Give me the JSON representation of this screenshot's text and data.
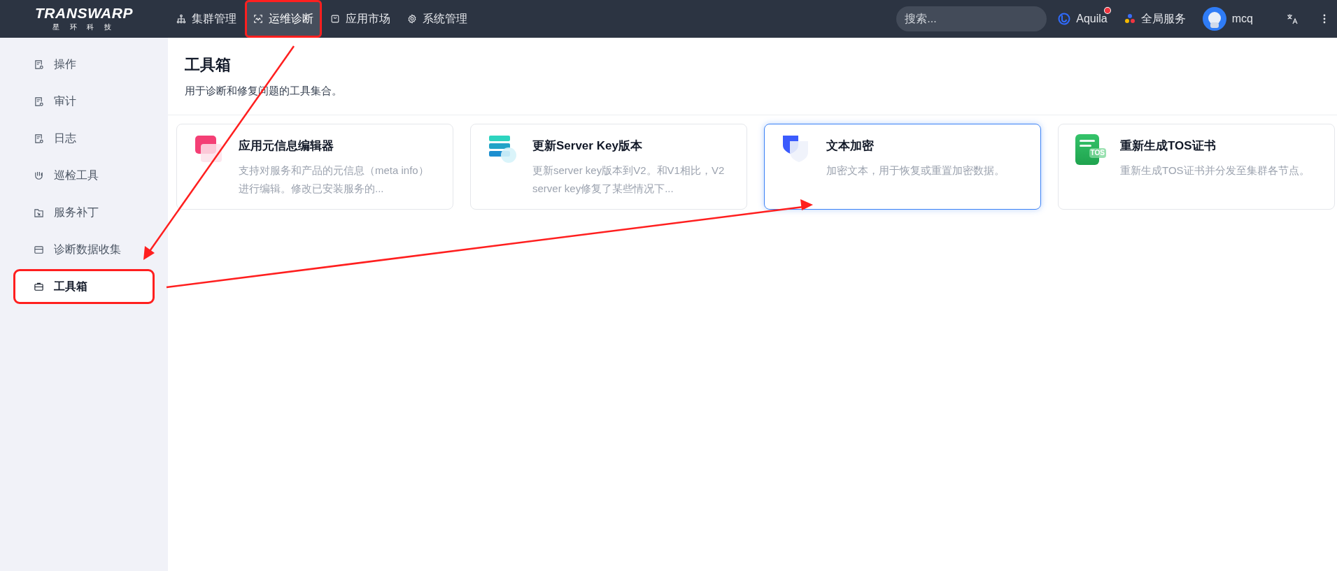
{
  "logo": {
    "name": "TRANSWARP",
    "subtitle": "星 环 科 技"
  },
  "nav": [
    {
      "label": "集群管理",
      "kind": "sitemap",
      "selected": false,
      "annotated": false
    },
    {
      "label": "运维诊断",
      "kind": "scan",
      "selected": true,
      "annotated": true
    },
    {
      "label": "应用市场",
      "kind": "bag",
      "selected": false,
      "annotated": false
    },
    {
      "label": "系统管理",
      "kind": "gear",
      "selected": false,
      "annotated": false
    }
  ],
  "search": {
    "placeholder": "搜索..."
  },
  "aquila": {
    "label": "Aquila",
    "notification": true
  },
  "global_services": {
    "label": "全局服务"
  },
  "user": {
    "name": "mcq"
  },
  "sidebar": {
    "items": [
      {
        "label": "操作",
        "kind": "doc",
        "selected": false,
        "annotated": false
      },
      {
        "label": "审计",
        "kind": "doc",
        "selected": false,
        "annotated": false
      },
      {
        "label": "日志",
        "kind": "doc",
        "selected": false,
        "annotated": false
      },
      {
        "label": "巡检工具",
        "kind": "hand",
        "selected": false,
        "annotated": false
      },
      {
        "label": "服务补丁",
        "kind": "folder",
        "selected": false,
        "annotated": false
      },
      {
        "label": "诊断数据收集",
        "kind": "box",
        "selected": false,
        "annotated": false
      },
      {
        "label": "工具箱",
        "kind": "toolbox",
        "selected": true,
        "annotated": true
      }
    ]
  },
  "page": {
    "title": "工具箱",
    "subtitle": "用于诊断和修复问题的工具集合。"
  },
  "cards": [
    {
      "title": "应用元信息编辑器",
      "description": "支持对服务和产品的元信息（meta info）进行编辑。修改已安装服务的...",
      "kind": "editor",
      "selected": false
    },
    {
      "title": "更新Server Key版本",
      "description": "更新server key版本到V2。和V1相比，V2 server key修复了某些情况下...",
      "kind": "server",
      "selected": false
    },
    {
      "title": "文本加密",
      "description": "加密文本，用于恢复或重置加密数据。",
      "kind": "shield",
      "selected": true
    },
    {
      "title": "重新生成TOS证书",
      "description": "重新生成TOS证书并分发至集群各节点。",
      "kind": "cert",
      "icon_text": "TOS",
      "selected": false
    }
  ]
}
